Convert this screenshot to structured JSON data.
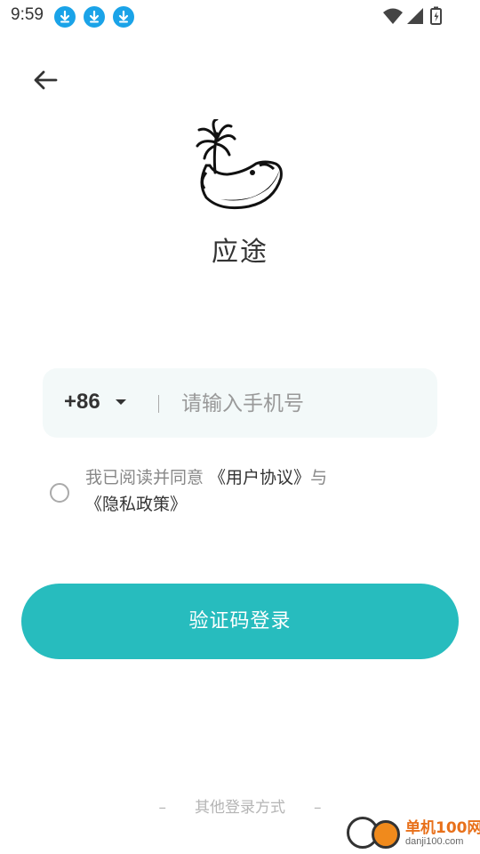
{
  "status_bar": {
    "time": "9:59",
    "notification_icons": [
      "download-icon",
      "download-icon",
      "download-icon"
    ],
    "right_icons": [
      "wifi-icon",
      "signal-icon",
      "battery-charging-icon"
    ]
  },
  "nav": {
    "back_icon": "arrow-left-icon"
  },
  "app": {
    "logo_icon": "whale-icon",
    "name": "应途"
  },
  "phone": {
    "country_code": "+86",
    "placeholder": "请输入手机号",
    "value": ""
  },
  "agreement": {
    "prefix": "我已阅读并同意 ",
    "user_agreement": "《用户协议》",
    "connector": "与",
    "privacy_policy": "《隐私政策》",
    "checked": false
  },
  "login": {
    "button_label": "验证码登录"
  },
  "other_login": {
    "dash_left": "–",
    "label": "其他登录方式",
    "dash_right": "–"
  },
  "watermark": {
    "name": "单机100网",
    "url": "danji100.com"
  },
  "colors": {
    "accent": "#27bcbe",
    "input_bg": "#f3f9f9",
    "notification_blue": "#1aa3e8",
    "watermark_orange": "#e8701a"
  }
}
